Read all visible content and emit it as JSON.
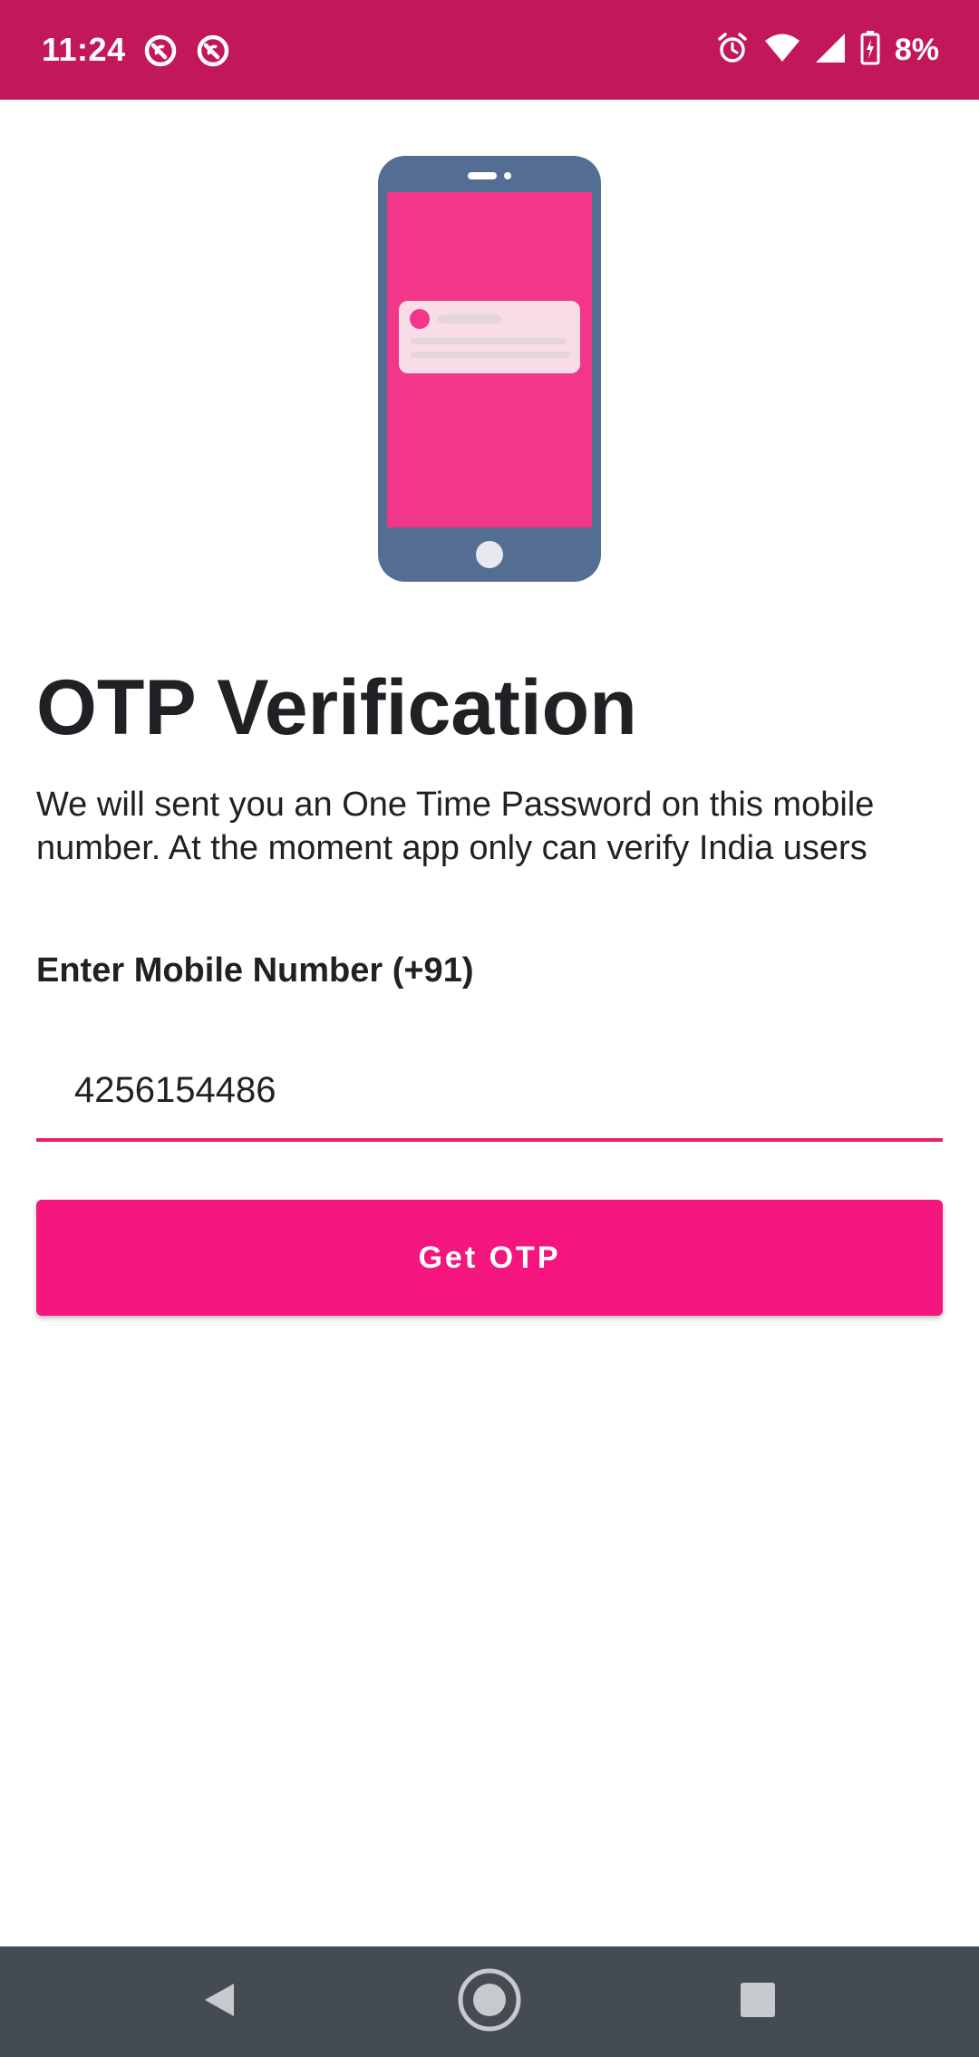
{
  "status_bar": {
    "time": "11:24",
    "left_icons": [
      "sync-icon",
      "sync-icon"
    ],
    "right_icons": [
      "alarm-icon",
      "wifi-icon",
      "cell-signal-icon",
      "battery-charging-icon"
    ],
    "battery_percent": "8%",
    "background_color": "#c2185b"
  },
  "illustration": {
    "name": "phone-notification-illustration"
  },
  "main": {
    "title": "OTP Verification",
    "description": "We will sent you an One Time Password on this mobile number. At the moment app only can verify India users",
    "field_label": "Enter Mobile Number (+91)",
    "phone_value": "4256154486",
    "button_label": "Get OTP",
    "accent_color": "#f4157f"
  },
  "nav_bar": {
    "buttons": [
      "back-icon",
      "home-icon",
      "recents-icon"
    ],
    "background_color": "#454b52"
  }
}
